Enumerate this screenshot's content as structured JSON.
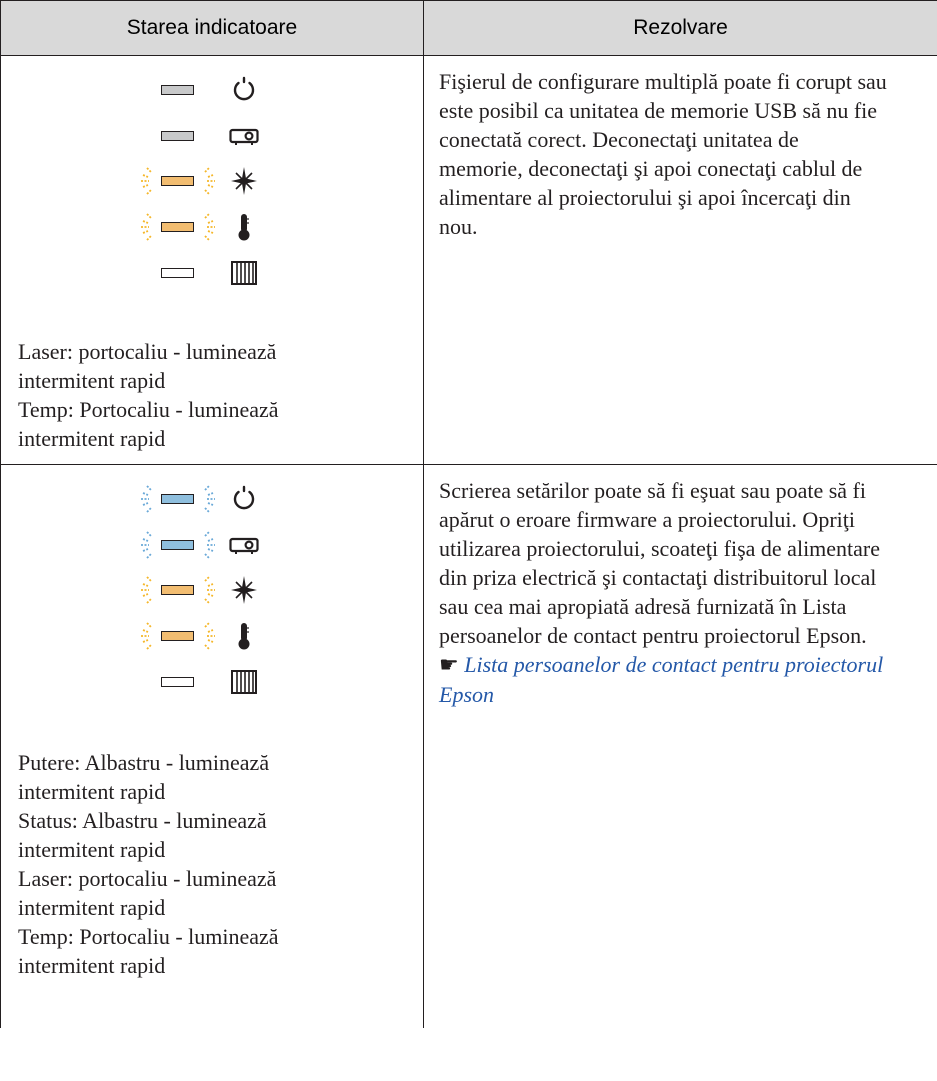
{
  "headers": {
    "status": "Starea indicatoare",
    "resolution": "Rezolvare"
  },
  "rows": [
    {
      "indicators": [
        {
          "name": "power",
          "icon": "power-icon",
          "color": "gray",
          "flashing": false
        },
        {
          "name": "status",
          "icon": "projector-icon",
          "color": "gray",
          "flashing": false
        },
        {
          "name": "laser",
          "icon": "laser-icon",
          "color": "orange",
          "flashing": true
        },
        {
          "name": "temp",
          "icon": "thermometer-icon",
          "color": "orange",
          "flashing": true
        },
        {
          "name": "filter",
          "icon": "filter-icon",
          "color": "off",
          "flashing": false
        }
      ],
      "status_lines": [
        "Laser: portocaliu - luminează",
        "intermitent rapid",
        "Temp: Portocaliu - luminează",
        "intermitent rapid"
      ],
      "resolution_lines": [
        "Fişierul de configurare multiplă poate fi corupt sau",
        "este posibil ca unitatea de memorie USB să nu fie",
        "conectată corect. Deconectaţi unitatea de",
        "memorie, deconectaţi şi apoi conectaţi cablul de",
        "alimentare al proiectorului şi apoi încercaţi din",
        "nou."
      ]
    },
    {
      "indicators": [
        {
          "name": "power",
          "icon": "power-icon",
          "color": "blue",
          "flashing": true
        },
        {
          "name": "status",
          "icon": "projector-icon",
          "color": "blue",
          "flashing": true
        },
        {
          "name": "laser",
          "icon": "laser-icon",
          "color": "orange",
          "flashing": true
        },
        {
          "name": "temp",
          "icon": "thermometer-icon",
          "color": "orange",
          "flashing": true
        },
        {
          "name": "filter",
          "icon": "filter-icon",
          "color": "off",
          "flashing": false
        }
      ],
      "status_lines": [
        "Putere: Albastru - luminează",
        "intermitent rapid",
        "Status: Albastru - luminează",
        "intermitent rapid",
        "Laser: portocaliu - luminează",
        "intermitent rapid",
        "Temp: Portocaliu - luminează",
        "intermitent rapid"
      ],
      "resolution_lines": [
        "Scrierea setărilor poate să fi eşuat sau poate să fi",
        "apărut o eroare firmware a proiectorului. Opriţi",
        "utilizarea proiectorului, scoateţi fişa de alimentare",
        "din priza electrică şi contactaţi distribuitorul local",
        "sau cea mai apropiată adresă furnizată în Lista",
        "persoanelor de contact pentru proiectorul Epson."
      ],
      "link_lines": [
        "Lista persoanelor de contact pentru proiectorul",
        "Epson"
      ],
      "link_icon": "pointing-hand-icon"
    }
  ],
  "colors": {
    "header_bg": "#d9d9d9",
    "gray_led": "#c8c9ca",
    "orange_led": "#f2bd71",
    "blue_led": "#8fbfde",
    "orange_rays": "#f5b72a",
    "blue_rays": "#6aa9d8",
    "link": "#2458a8"
  }
}
